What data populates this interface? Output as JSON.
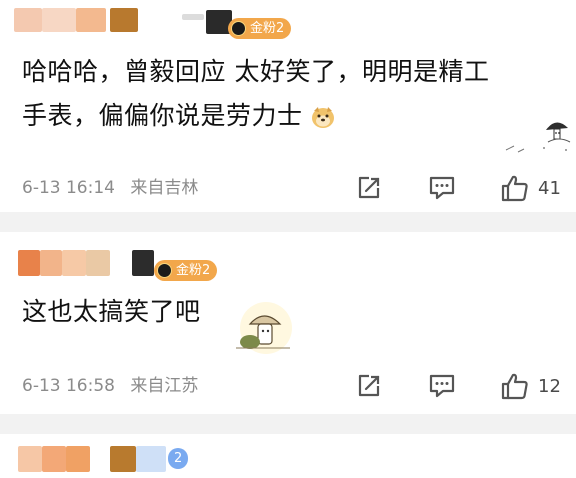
{
  "comments": [
    {
      "badge": "金粉2",
      "text_line1": "哈哈哈，曾毅回应 太好笑了，明明是精工",
      "text_line2": "手表，偏偏你说是劳力士",
      "date": "6-13 16:14",
      "location": "来自吉林",
      "like_count": "41"
    },
    {
      "badge": "金粉2",
      "text": "这也太搞笑了吧",
      "date": "6-13 16:58",
      "location": "来自江苏",
      "like_count": "12"
    },
    {
      "badge": "2"
    }
  ],
  "icons": {
    "repost": "repost-icon",
    "comment": "comment-icon",
    "like": "like-icon",
    "sticker": "doge-sticker-icon"
  },
  "colors": {
    "badge_bg": "#f2a74b",
    "badge_blue": "#7aaaf0",
    "meta_text": "#8b8b8b",
    "icon_stroke": "#555555",
    "divider": "#f2f2f2"
  }
}
